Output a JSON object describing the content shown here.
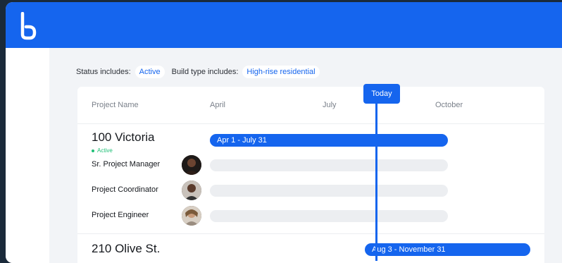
{
  "filters": {
    "status_label": "Status includes:",
    "status_value": "Active",
    "build_label": "Build type includes:",
    "build_value": "High-rise residential"
  },
  "timeline": {
    "headers": {
      "project_name": "Project Name",
      "april": "April",
      "july": "July",
      "october": "October"
    },
    "today_label": "Today"
  },
  "projects": [
    {
      "name": "100 Victoria",
      "status": "Active",
      "bar_label": "Apr 1 - July 31",
      "roles": [
        "Sr. Project Manager",
        "Project Coordinator",
        "Project Engineer"
      ]
    },
    {
      "name": "210 Olive St.",
      "bar_label": "Aug 3 - November 31"
    }
  ],
  "colors": {
    "brand_blue": "#1565ee",
    "active_green": "#1fbf76"
  },
  "icons": {
    "logo": "brand-logo"
  }
}
